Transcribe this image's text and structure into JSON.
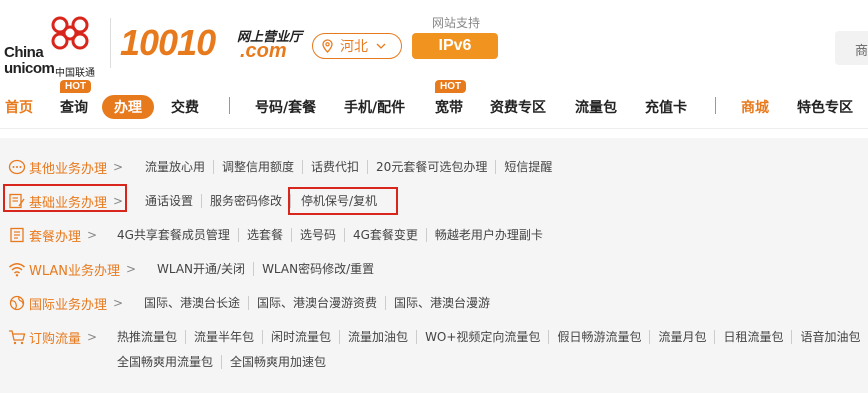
{
  "header": {
    "logo_text_line1": "China",
    "logo_text_line2": "unicom",
    "logo_text_cn": "中国联通",
    "brand_number": "10010",
    "brand_cn": "网上营业厅",
    "brand_domain": ".com",
    "region": "河北",
    "ipv6_label": "网站支持",
    "ipv6_badge": "IPv6",
    "search_stub": "商"
  },
  "nav": {
    "items": [
      {
        "label": "首页"
      },
      {
        "label": "查询",
        "badge": "HOT"
      },
      {
        "label": "办理"
      },
      {
        "label": "交费"
      },
      {
        "label": "号码/套餐"
      },
      {
        "label": "手机/配件"
      },
      {
        "label": "宽带",
        "badge": "HOT"
      },
      {
        "label": "资费专区"
      },
      {
        "label": "流量包"
      },
      {
        "label": "充值卡"
      },
      {
        "label": "商城"
      },
      {
        "label": "特色专区"
      }
    ]
  },
  "panel": {
    "rows": [
      {
        "category": "其他业务办理",
        "links": [
          "流量放心用",
          "调整信用额度",
          "话费代扣",
          "20元套餐可选包办理",
          "短信提醒"
        ]
      },
      {
        "category": "基础业务办理",
        "links": [
          "通话设置",
          "服务密码修改",
          "停机保号/复机"
        ]
      },
      {
        "category": "套餐办理",
        "links": [
          "4G共享套餐成员管理",
          "选套餐",
          "选号码",
          "4G套餐变更",
          "畅越老用户办理副卡"
        ]
      },
      {
        "category": "WLAN业务办理",
        "links": [
          "WLAN开通/关闭",
          "WLAN密码修改/重置"
        ]
      },
      {
        "category": "国际业务办理",
        "links": [
          "国际、港澳台长途",
          "国际、港澳台漫游资费",
          "国际、港澳台漫游"
        ]
      },
      {
        "category": "订购流量",
        "links": [
          "热推流量包",
          "流量半年包",
          "闲时流量包",
          "流量加油包",
          "WO+视频定向流量包",
          "假日畅游流量包",
          "流量月包",
          "日租流量包",
          "语音加油包"
        ],
        "links2": [
          "全国畅爽用流量包",
          "全国畅爽用加速包"
        ]
      }
    ]
  },
  "colors": {
    "accent": "#e87a1e",
    "highlight_box": "#d9261c"
  }
}
